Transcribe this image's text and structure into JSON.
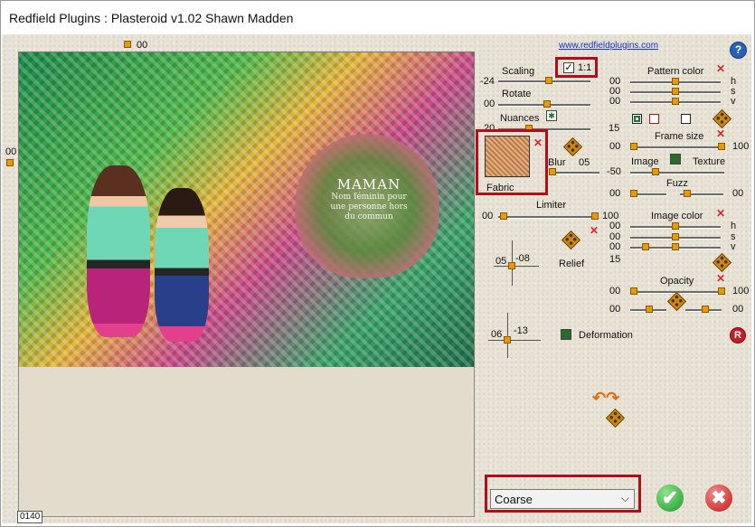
{
  "window": {
    "title": "Redfield Plugins : Plasteroid v1.02   Shawn Madden"
  },
  "top_left_value": "00",
  "left_value": "00",
  "preview_text": {
    "line1": "MAMAN",
    "line2": "Nom féminin pour",
    "line3": "une personne hors",
    "line4": "du commun"
  },
  "counter": "0140",
  "link": "www.redfieldplugins.com",
  "help": "?",
  "scaling": {
    "label": "Scaling",
    "value": "-24",
    "checkbox_label": "1:1",
    "level": 0.55
  },
  "rotate": {
    "label": "Rotate",
    "value": "00",
    "level": 0.5
  },
  "nuances": {
    "label": "Nuances",
    "left_value": "20",
    "right_value": "15",
    "level": 0.5
  },
  "fabric": {
    "label": "Fabric"
  },
  "blur": {
    "label": "Blur",
    "value": "05",
    "level": 0.1
  },
  "limiter": {
    "label": "Limiter",
    "left": "00",
    "right": "100",
    "level": 1.0
  },
  "relief": {
    "label": "Relief",
    "x": "05",
    "y": "-08"
  },
  "deform_pad": {
    "x": "06",
    "y": "-13"
  },
  "deformation": {
    "label": "Deformation"
  },
  "pattern_color": {
    "label": "Pattern color",
    "h": "00",
    "s": "00",
    "v": "00",
    "h_label": "h",
    "s_label": "s",
    "v_label": "v"
  },
  "frame_size": {
    "label": "Frame size",
    "left": "00",
    "right": "100"
  },
  "image_texture": {
    "left_value": "-50",
    "label_image": "Image",
    "label_texture": "Texture"
  },
  "fuzz": {
    "label": "Fuzz",
    "left": "00",
    "right": "00"
  },
  "image_color": {
    "label": "Image color",
    "h": "00",
    "s": "00",
    "v": "00",
    "v_right": "15",
    "h_label": "h",
    "s_label": "s",
    "v_label": "v"
  },
  "opacity": {
    "label": "Opacity",
    "left": "00",
    "right": "100",
    "left2": "00",
    "right2": "00"
  },
  "reset": "R",
  "mode_select": {
    "value": "Coarse"
  },
  "ok": "✔",
  "cancel": "✖"
}
